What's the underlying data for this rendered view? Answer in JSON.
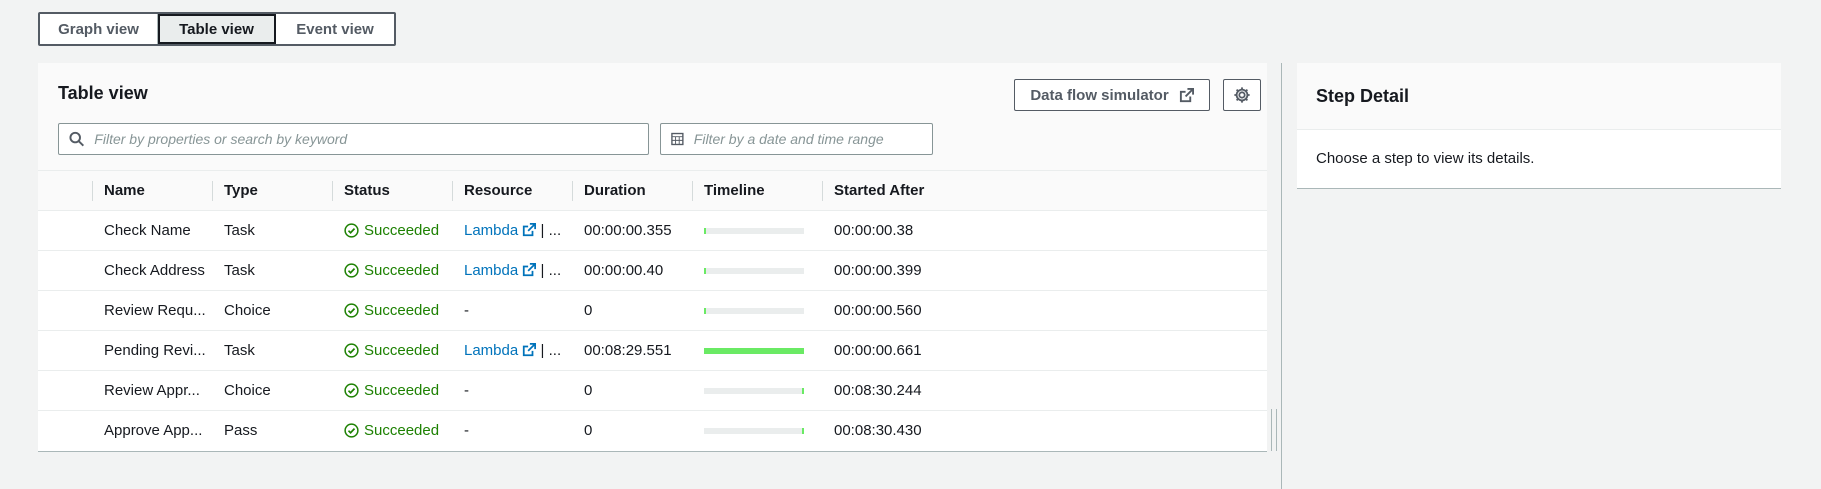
{
  "view_tabs": [
    "Graph view",
    "Table view",
    "Event view"
  ],
  "panel": {
    "title": "Table view",
    "simulator_label": "Data flow simulator",
    "search_placeholder": "Filter by properties or search by keyword",
    "date_placeholder": "Filter by a date and time range"
  },
  "columns": [
    "Name",
    "Type",
    "Status",
    "Resource",
    "Duration",
    "Timeline",
    "Started After"
  ],
  "rows": [
    {
      "name": "Check Name",
      "type": "Task",
      "status": "Succeeded",
      "resource": "Lambda",
      "resource_more": " | ...",
      "duration": "00:00:00.355",
      "timeline_start": 0.0,
      "timeline_width": 0.01,
      "started_after": "00:00:00.38"
    },
    {
      "name": "Check Address",
      "type": "Task",
      "status": "Succeeded",
      "resource": "Lambda",
      "resource_more": " | ...",
      "duration": "00:00:00.40",
      "timeline_start": 0.0,
      "timeline_width": 0.01,
      "started_after": "00:00:00.399"
    },
    {
      "name": "Review Requ...",
      "type": "Choice",
      "status": "Succeeded",
      "resource": "-",
      "resource_more": "",
      "duration": "0",
      "timeline_start": 0.0,
      "timeline_width": 0.01,
      "started_after": "00:00:00.560"
    },
    {
      "name": "Pending Revi...",
      "type": "Task",
      "status": "Succeeded",
      "resource": "Lambda",
      "resource_more": " | ...",
      "duration": "00:08:29.551",
      "timeline_start": 0.0,
      "timeline_width": 1.0,
      "started_after": "00:00:00.661"
    },
    {
      "name": "Review Appr...",
      "type": "Choice",
      "status": "Succeeded",
      "resource": "-",
      "resource_more": "",
      "duration": "0",
      "timeline_start": 0.99,
      "timeline_width": 0.01,
      "started_after": "00:08:30.244"
    },
    {
      "name": "Approve App...",
      "type": "Pass",
      "status": "Succeeded",
      "resource": "-",
      "resource_more": "",
      "duration": "0",
      "timeline_start": 0.99,
      "timeline_width": 0.01,
      "started_after": "00:08:30.430"
    }
  ],
  "step_detail": {
    "title": "Step Detail",
    "message": "Choose a step to view its details."
  },
  "colors": {
    "success": "#1d8102",
    "link": "#0073bb",
    "timeline": "#6aea64"
  },
  "icons": [
    "search-icon",
    "calendar-icon",
    "external-link-icon",
    "gear-icon",
    "check-circle-icon"
  ]
}
